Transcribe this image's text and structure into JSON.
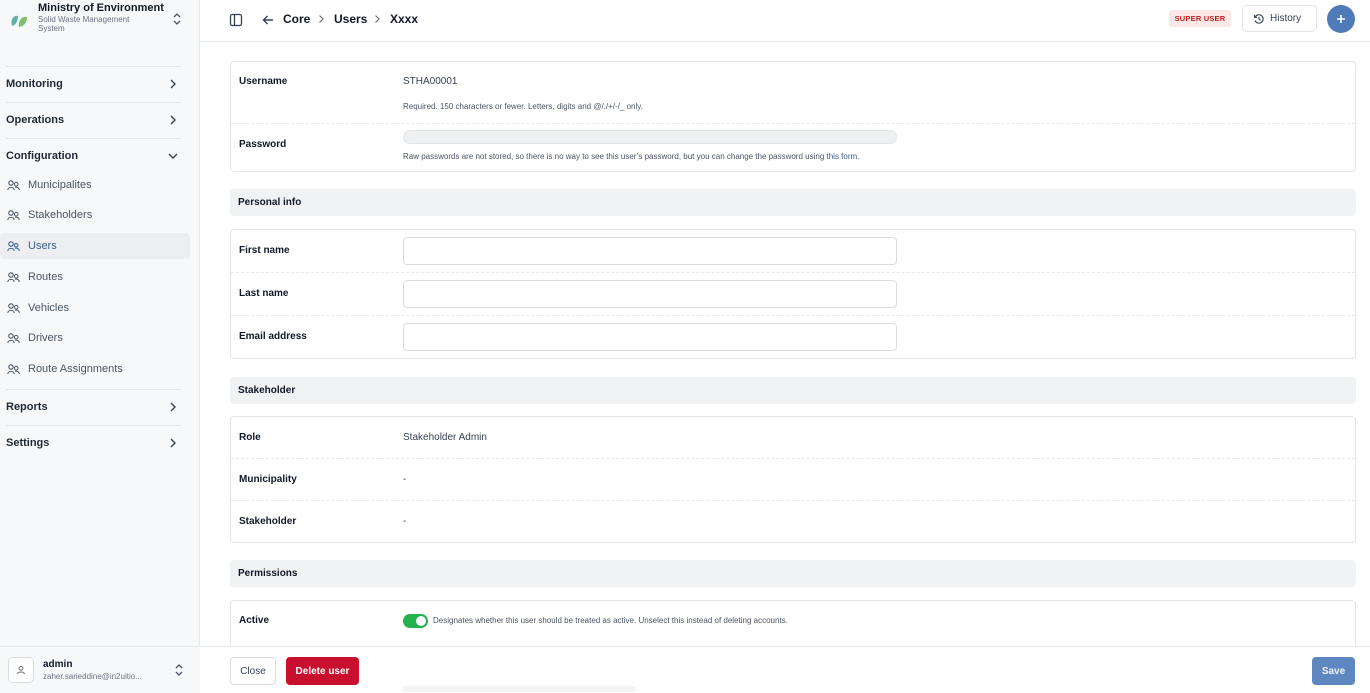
{
  "brand": {
    "title": "Ministry of Environment",
    "subtitle_line1": "Solid Waste Management",
    "subtitle_line2": "System",
    "accent": "#4f7bb8"
  },
  "sidebar": {
    "sections": [
      {
        "label": "Monitoring"
      },
      {
        "label": "Operations"
      },
      {
        "label": "Configuration"
      },
      {
        "label": "Reports"
      },
      {
        "label": "Settings"
      }
    ],
    "config_items": [
      {
        "label": "Municipalites",
        "icon": "users-icon"
      },
      {
        "label": "Stakeholders",
        "icon": "users-icon"
      },
      {
        "label": "Users",
        "icon": "users-icon",
        "active": true
      },
      {
        "label": "Routes",
        "icon": "users-icon"
      },
      {
        "label": "Vehicles",
        "icon": "users-icon"
      },
      {
        "label": "Drivers",
        "icon": "users-icon"
      },
      {
        "label": "Route Assignments",
        "icon": "users-icon"
      }
    ],
    "user": {
      "name": "admin",
      "email": "zaher.sarieddine@in2uitio..."
    }
  },
  "topbar": {
    "breadcrumbs": [
      "Core",
      "Users",
      "Xxxx"
    ],
    "badge": "SUPER USER",
    "history_label": "History"
  },
  "form": {
    "username": {
      "label": "Username",
      "value": "STHA00001",
      "help": "Required. 150 characters or fewer. Letters, digits and @/./+/-/_ only."
    },
    "password": {
      "label": "Password",
      "help_prefix": "Raw passwords are not stored, so there is no way to see this user’s password, but you can change the password using ",
      "help_link": "this form",
      "help_suffix": "."
    },
    "personal_info": {
      "heading": "Personal info",
      "first_name": {
        "label": "First name",
        "value": ""
      },
      "last_name": {
        "label": "Last name",
        "value": ""
      },
      "email": {
        "label": "Email address",
        "value": ""
      }
    },
    "stakeholder": {
      "heading": "Stakeholder",
      "role": {
        "label": "Role",
        "value": "Stakeholder Admin"
      },
      "municipality": {
        "label": "Municipality",
        "value": "-"
      },
      "stakeholder": {
        "label": "Stakeholder",
        "value": "-"
      }
    },
    "permissions": {
      "heading": "Permissions",
      "active": {
        "label": "Active",
        "checked": true,
        "help": "Designates whether this user should be treated as active. Unselect this instead of deleting accounts."
      }
    }
  },
  "footer": {
    "close_label": "Close",
    "delete_label": "Delete user",
    "save_label": "Save"
  }
}
